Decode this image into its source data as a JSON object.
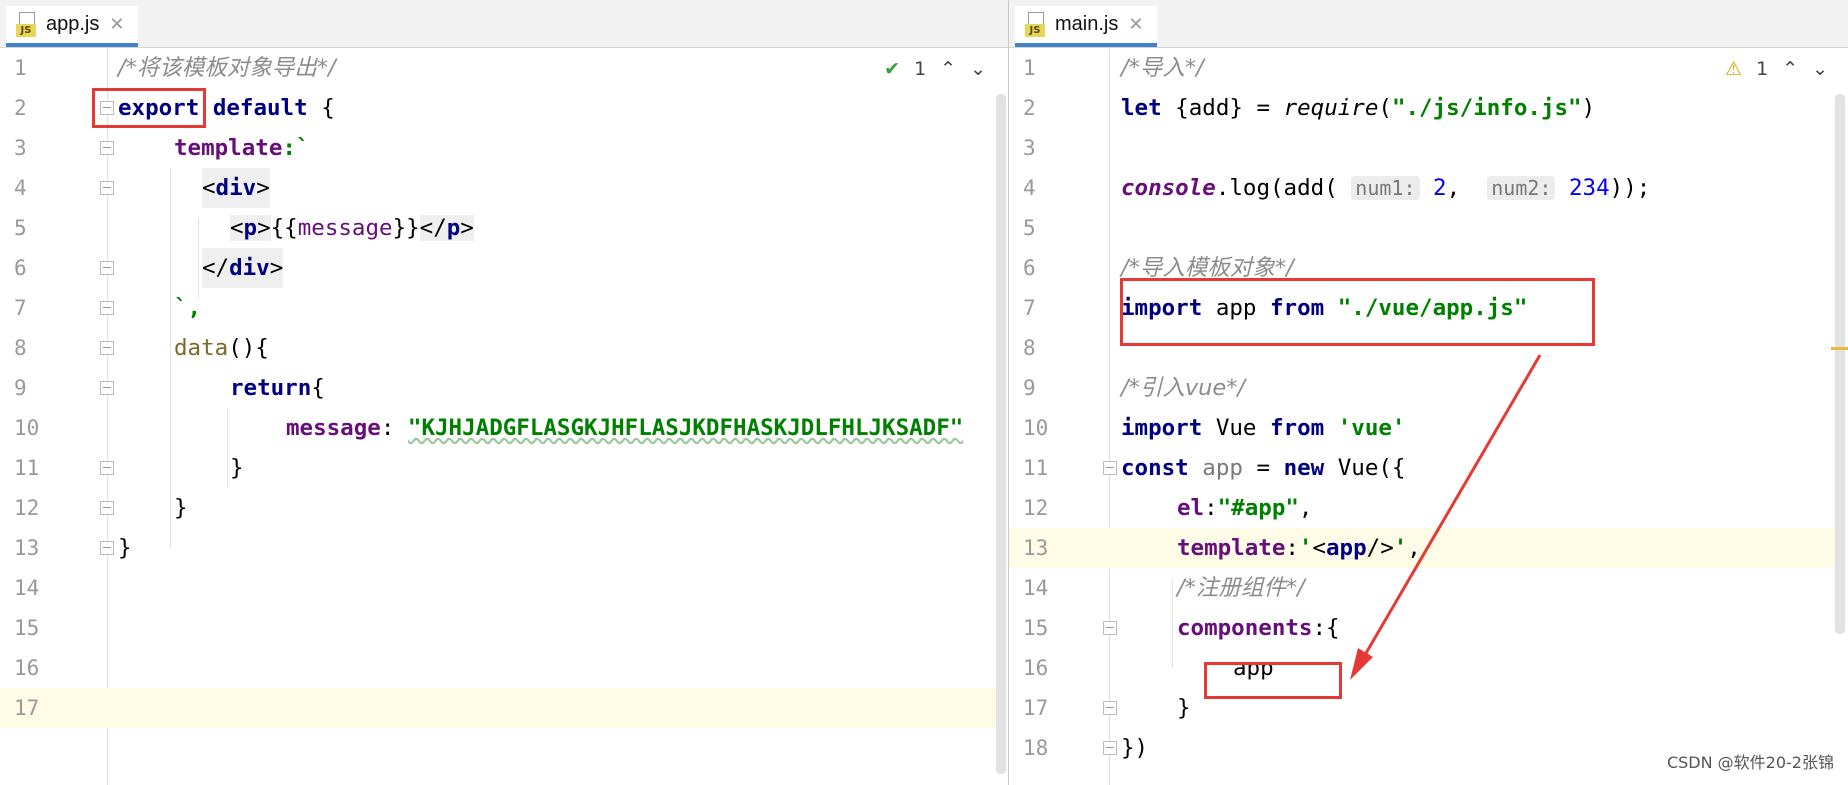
{
  "left": {
    "tab": {
      "label": "app.js",
      "close": "✕",
      "icon": "JS"
    },
    "indicator": {
      "count": "1",
      "up": "⌃",
      "down": "⌄",
      "icon": "check-icon"
    },
    "lines": {
      "l1": {
        "n": "1",
        "c1": "/*将该模板对象导出*/"
      },
      "l2": {
        "n": "2",
        "c1": "export",
        "c2": " ",
        "c3": "default",
        "c4": " {"
      },
      "l3": {
        "n": "3",
        "c1": "template",
        "c2": ":`"
      },
      "l4": {
        "n": "4",
        "c1": "<",
        "c2": "div",
        "c3": ">"
      },
      "l5": {
        "n": "5",
        "c1": "<",
        "c2": "p",
        "c3": ">",
        "c4": "{{",
        "c5": "message",
        "c6": "}}",
        "c7": "</",
        "c8": "p",
        "c9": ">"
      },
      "l6": {
        "n": "6",
        "c1": "</",
        "c2": "div",
        "c3": ">"
      },
      "l7": {
        "n": "7",
        "c1": "`,"
      },
      "l8": {
        "n": "8",
        "c1": "data",
        "c2": "(){"
      },
      "l9": {
        "n": "9",
        "c1": "return",
        "c2": "{"
      },
      "l10": {
        "n": "10",
        "c1": "message",
        "c2": ": ",
        "c3": "\"KJHJADGFLASGKJHFLASJKDFHASKJDLFHLJKSADF\""
      },
      "l11": {
        "n": "11",
        "c1": "}"
      },
      "l12": {
        "n": "12",
        "c1": "}"
      },
      "l13": {
        "n": "13",
        "c1": "}"
      },
      "l14": {
        "n": "14"
      },
      "l15": {
        "n": "15"
      },
      "l16": {
        "n": "16"
      },
      "l17": {
        "n": "17"
      }
    }
  },
  "right": {
    "tab": {
      "label": "main.js",
      "close": "✕",
      "icon": "JS"
    },
    "indicator": {
      "count": "1",
      "up": "⌃",
      "down": "⌄",
      "icon": "warning-icon"
    },
    "lines": {
      "l1": {
        "n": "1",
        "c1": "/*导入*/"
      },
      "l2": {
        "n": "2",
        "c1": "let",
        "c2": " {add} = ",
        "c3": "require",
        "c4": "(",
        "c5": "\"./js/info.js\"",
        "c6": ")"
      },
      "l3": {
        "n": "3"
      },
      "l4": {
        "n": "4",
        "c1": "console",
        "c2": ".log(add( ",
        "c3": "num1:",
        "c4": " 2",
        "c5": ",  ",
        "c6": "num2:",
        "c7": " 234",
        "c8": "));"
      },
      "l5": {
        "n": "5"
      },
      "l6": {
        "n": "6",
        "c1": "/*导入模板对象*/"
      },
      "l7": {
        "n": "7",
        "c1": "import",
        "c2": " app ",
        "c3": "from",
        "c4": " ",
        "c5": "\"./vue/app.js\""
      },
      "l8": {
        "n": "8"
      },
      "l9": {
        "n": "9",
        "c1": "/*引入vue*/"
      },
      "l10": {
        "n": "10",
        "c1": "import",
        "c2": " Vue ",
        "c3": "from",
        "c4": " ",
        "c5": "'vue'"
      },
      "l11": {
        "n": "11",
        "c1": "const",
        "c2": " app",
        "c3": " = ",
        "c4": "new",
        "c5": " Vue({"
      },
      "l12": {
        "n": "12",
        "c1": "el",
        "c2": ":",
        "c3": "\"#app\"",
        "c4": ","
      },
      "l13": {
        "n": "13",
        "c1": "template",
        "c2": ":",
        "c3": "'",
        "c4": "<",
        "c5": "app",
        "c6": "/>",
        "c7": "'",
        "c8": ","
      },
      "l14": {
        "n": "14",
        "c1": "/*注册组件*/"
      },
      "l15": {
        "n": "15",
        "c1": "components",
        "c2": ":{"
      },
      "l16": {
        "n": "16",
        "c1": "app"
      },
      "l17": {
        "n": "17",
        "c1": "}"
      },
      "l18": {
        "n": "18",
        "c1": "})"
      }
    }
  },
  "watermark": "CSDN @软件20-2张锦",
  "colors": {
    "annotation": "#e53935",
    "keyword": "#000080",
    "string": "#008000",
    "property": "#660e7a",
    "number": "#0000ff",
    "comment": "#8c8c8c"
  }
}
